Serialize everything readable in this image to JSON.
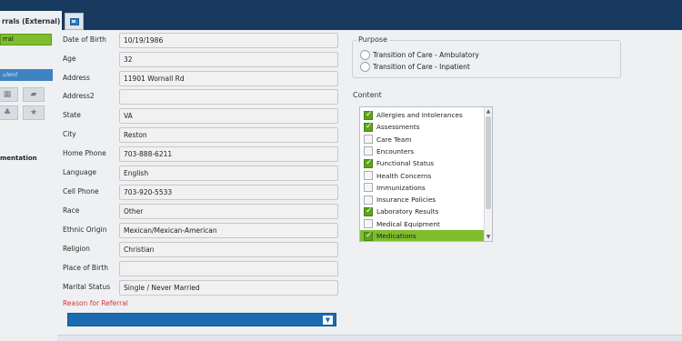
{
  "tabs": {
    "active_label": "rrals (External)",
    "pin_icon": "pin-icon",
    "new_tab_icon": "new-tab-icon"
  },
  "sidebar": {
    "active_item": "rral",
    "section_item": "ulent",
    "text_item": "mentation",
    "icons": [
      "grid-icon",
      "comment-icon",
      "thumbs-up-icon",
      "star-icon"
    ]
  },
  "patient_fields": [
    {
      "label": "Date of Birth",
      "value": "10/19/1986"
    },
    {
      "label": "Age",
      "value": "32"
    },
    {
      "label": "Address",
      "value": "11901 Wornall Rd"
    },
    {
      "label": "Address2",
      "value": ""
    },
    {
      "label": "State",
      "value": "VA"
    },
    {
      "label": "City",
      "value": "Reston"
    },
    {
      "label": "Home Phone",
      "value": "703-888-6211"
    },
    {
      "label": "Language",
      "value": "English"
    },
    {
      "label": "Cell Phone",
      "value": "703-920-5533"
    },
    {
      "label": "Race",
      "value": "Other"
    },
    {
      "label": "Ethnic Origin",
      "value": "Mexican/Mexican-American"
    },
    {
      "label": "Religion",
      "value": "Christian"
    },
    {
      "label": "Place of Birth",
      "value": ""
    },
    {
      "label": "Marital Status",
      "value": "Single / Never Married"
    }
  ],
  "reason": {
    "label": "Reason for Referral",
    "value": ""
  },
  "purpose": {
    "legend": "Purpose",
    "options": [
      "Transition of Care - Ambulatory",
      "Transition of Care - Inpatient"
    ]
  },
  "content": {
    "label": "Content",
    "items": [
      {
        "label": "Allergies and Intolerances",
        "checked": true
      },
      {
        "label": "Assessments",
        "checked": true
      },
      {
        "label": "Care Team",
        "checked": false
      },
      {
        "label": "Encounters",
        "checked": false
      },
      {
        "label": "Functional Status",
        "checked": true
      },
      {
        "label": "Health Concerns",
        "checked": false
      },
      {
        "label": "Immunizations",
        "checked": false
      },
      {
        "label": "Insurance Policies",
        "checked": false
      },
      {
        "label": "Laboratory Results",
        "checked": true
      },
      {
        "label": "Medical Equipment",
        "checked": false
      },
      {
        "label": "Medications",
        "checked": true,
        "selected": true
      }
    ]
  },
  "colors": {
    "topbar": "#173a5e",
    "accent_green": "#7ebd2e",
    "accent_blue": "#1c6bb0",
    "required_red": "#d9363e"
  }
}
